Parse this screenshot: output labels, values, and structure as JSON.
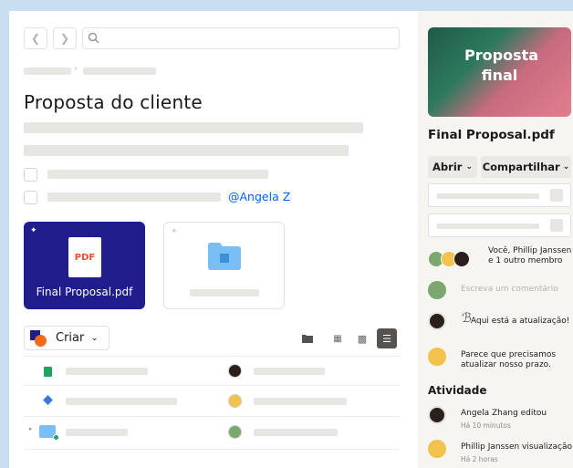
{
  "document": {
    "title": "Proposta do cliente",
    "mention": "@Angela Z"
  },
  "files": {
    "pdf_card": {
      "icon_label": "PDF",
      "name": "Final Proposal.pdf"
    },
    "create_label": "Criar"
  },
  "sidebar": {
    "preview_text": "Proposta final",
    "file_name": "Final Proposal.pdf",
    "open_label": "Abrir",
    "share_label": "Compartilhar",
    "members_text": "Você, Phillip Janssen e 1 outro membro",
    "comment_placeholder": "Escreva um comentário",
    "comments": [
      {
        "text": "Aqui está a atualização!"
      },
      {
        "text": "Parece que precisamos atualizar nosso prazo."
      }
    ],
    "activity_title": "Atividade",
    "activity": [
      {
        "text": "Angela Zhang editou",
        "time": "Há 10 minutos"
      },
      {
        "text": "Phillip Janssen visualização",
        "time": "Há 2 horas"
      }
    ]
  },
  "colors": {
    "accent_blue": "#0061fe",
    "pdf_card_bg": "#1f1d8b",
    "page_bg": "#c7dff1"
  },
  "icons": [
    "chevron-left-icon",
    "chevron-right-icon",
    "search-icon",
    "pin-icon",
    "folder-icon",
    "sheets-icon",
    "dropbox-paper-icon",
    "grid-view-icon",
    "list-view-icon",
    "cursor-icon"
  ]
}
